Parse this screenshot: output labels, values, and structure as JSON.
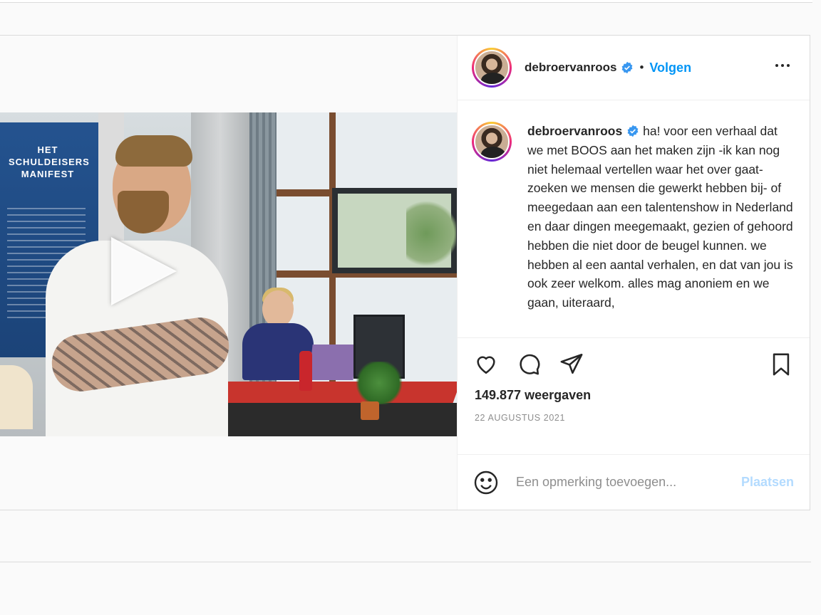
{
  "post": {
    "username": "debroervanroos",
    "follow_label": "Volgen",
    "separator": "•",
    "caption": "ha! voor een verhaal dat we met BOOS aan het maken zijn -ik kan nog niet helemaal vertellen waar het over gaat- zoeken we mensen die gewerkt hebben bij- of meegedaan aan een talentenshow in Nederland en daar dingen meegemaakt, gezien of gehoord hebben die niet door de beugel kunnen. we hebben al een aantal verhalen, en dat van jou is ook zeer welkom. alles mag anoniem en we gaan, uiteraard,",
    "views": "149.877 weergaven",
    "date": "22 augustus 2021",
    "comment_placeholder": "Een opmerking toevoegen...",
    "post_button": "Plaatsen"
  },
  "video": {
    "banner_text": "HET\nSCHULDEISERS\nMANIFEST",
    "muted": true
  },
  "icons": {
    "like": "heart-icon",
    "comment": "comment-icon",
    "share": "share-icon",
    "save": "bookmark-icon",
    "more": "more-options-icon",
    "verified": "verified-badge-icon",
    "emoji": "emoji-icon",
    "play": "play-icon",
    "mute": "muted-icon"
  },
  "colors": {
    "accent": "#0095f6",
    "accent_disabled": "#b3dbff",
    "verified": "#3897f0"
  }
}
